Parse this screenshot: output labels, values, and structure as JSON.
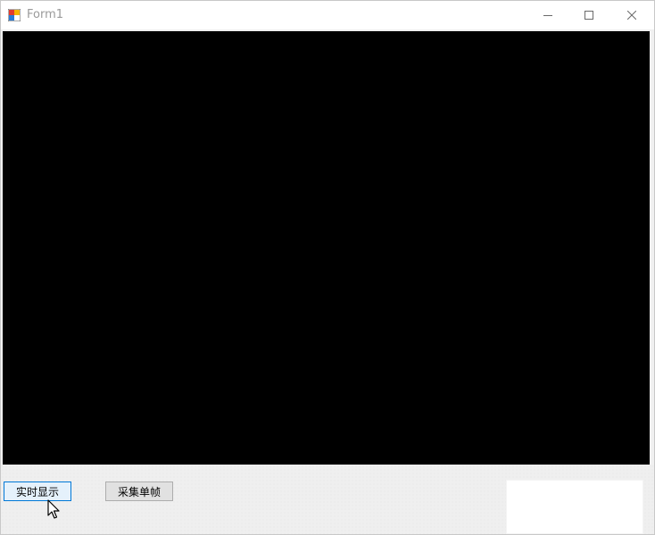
{
  "window": {
    "title": "Form1",
    "icon": "winforms-app-icon",
    "controls": {
      "minimize": "minimize-icon",
      "maximize": "maximize-icon",
      "close": "close-icon"
    }
  },
  "video": {
    "background": "#000000"
  },
  "buttons": {
    "live_label": "实时显示",
    "single_label": "采集单帧"
  },
  "colors": {
    "focus_border": "#0078d7",
    "button_face": "#e1e1e1",
    "window_bg": "#f0f0f0"
  }
}
